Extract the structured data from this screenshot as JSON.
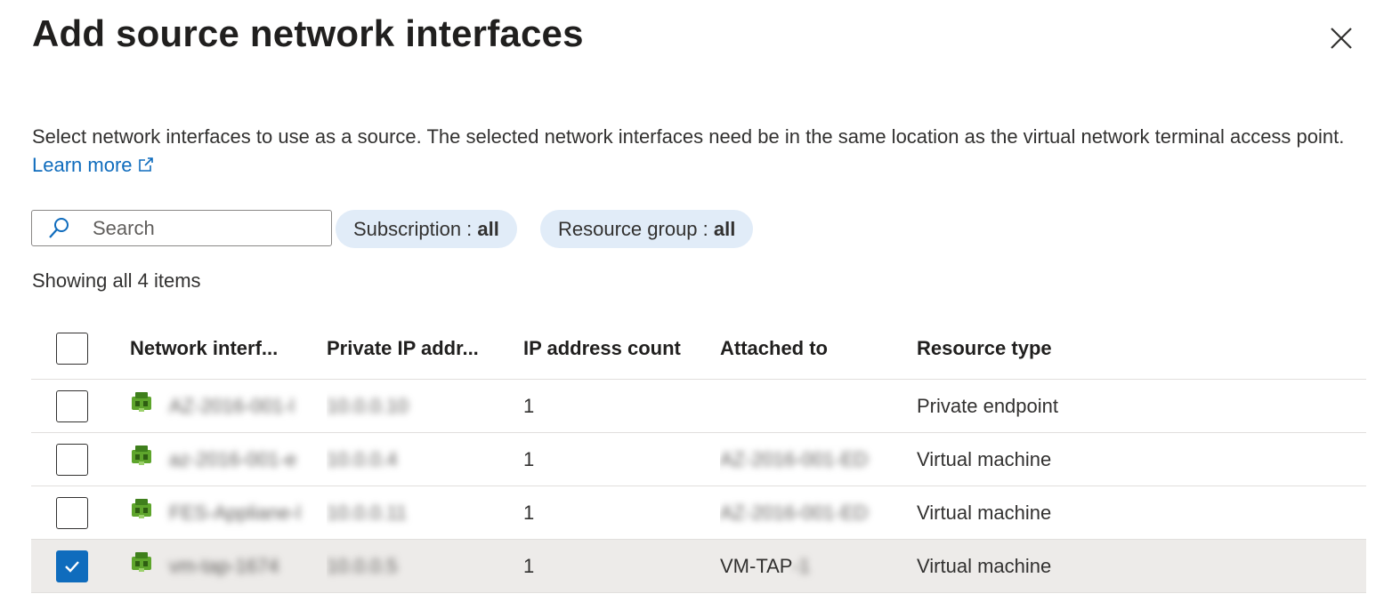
{
  "panel": {
    "title": "Add source network interfaces",
    "description": "Select network interfaces to use as a source. The selected network interfaces need be in the same location as the virtual network terminal access point.",
    "learn_more": "Learn more"
  },
  "search": {
    "placeholder": "Search"
  },
  "filters": [
    {
      "label": "Subscription : ",
      "value": "all"
    },
    {
      "label": "Resource group : ",
      "value": "all"
    }
  ],
  "count_text": "Showing all 4 items",
  "table": {
    "columns": [
      "Network interf...",
      "Private IP addr...",
      "IP address count",
      "Attached to",
      "Resource type"
    ],
    "rows": [
      {
        "name": "AZ-2016-001-l",
        "ip": "10.0.0.10",
        "count": "1",
        "attached_clear": "",
        "attached_blur": "",
        "type": "Private endpoint",
        "selected": false
      },
      {
        "name": "az-2016-001-e",
        "ip": "10.0.0.4",
        "count": "1",
        "attached_clear": "",
        "attached_blur": "AZ-2016-001-ED",
        "type": "Virtual machine",
        "selected": false
      },
      {
        "name": "FES-Appliane-l",
        "ip": "10.0.0.11",
        "count": "1",
        "attached_clear": "",
        "attached_blur": "AZ-2016-001-ED",
        "type": "Virtual machine",
        "selected": false
      },
      {
        "name": "vm-tap-1674",
        "ip": "10.0.0.5",
        "count": "1",
        "attached_clear": "VM-TAP",
        "attached_blur": "-1",
        "type": "Virtual machine",
        "selected": true
      }
    ]
  },
  "colors": {
    "accent": "#0f6cbd",
    "pill_bg": "#e1ecf8",
    "selected_row": "#edebe9",
    "nic_icon": "#5ea52c"
  }
}
